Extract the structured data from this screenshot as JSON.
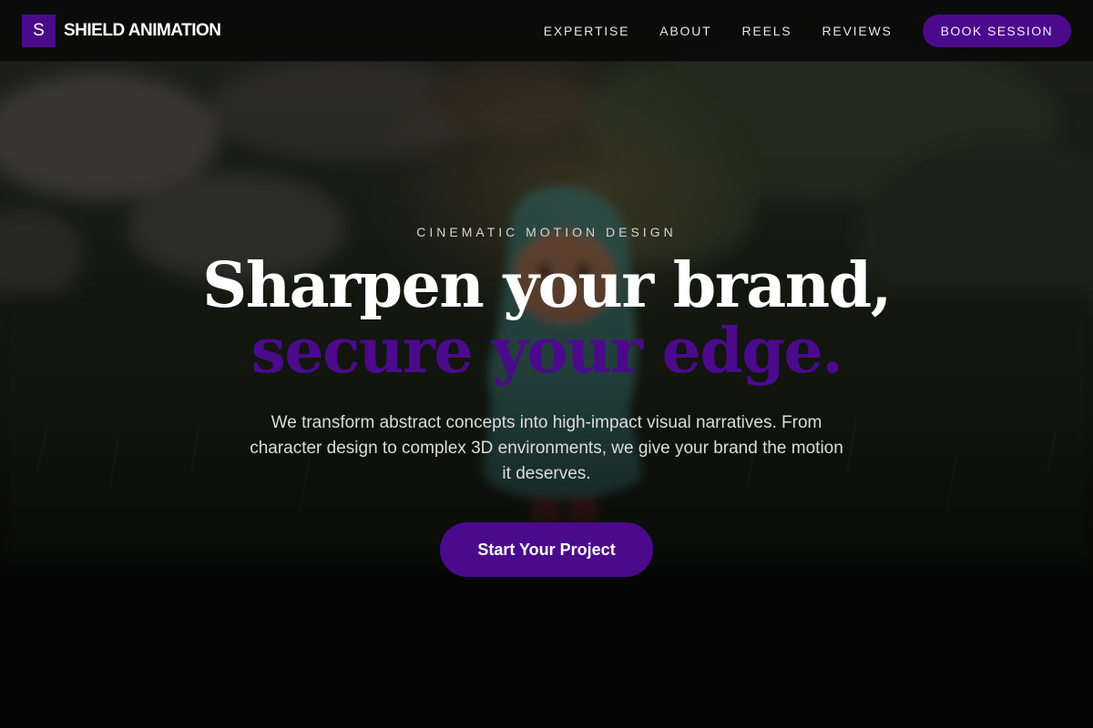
{
  "nav": {
    "brand_letter": "S",
    "brand_name": "SHIELD ANIMATION",
    "links": [
      {
        "label": "EXPERTISE"
      },
      {
        "label": "ABOUT"
      },
      {
        "label": "REELS"
      },
      {
        "label": "REVIEWS"
      }
    ],
    "cta_label": "BOOK SESSION"
  },
  "hero": {
    "eyebrow": "CINEMATIC MOTION DESIGN",
    "headline_line1": "Sharpen your brand,",
    "headline_line2": "secure your edge.",
    "subcopy": "We transform abstract concepts into high-impact visual narratives. From character design to complex 3D environments, we give your brand the motion it deserves.",
    "cta_label": "Start Your Project"
  },
  "colors": {
    "accent": "#4b0a8c",
    "nav_background": "#0a0a0a",
    "text_primary": "#ffffff"
  }
}
